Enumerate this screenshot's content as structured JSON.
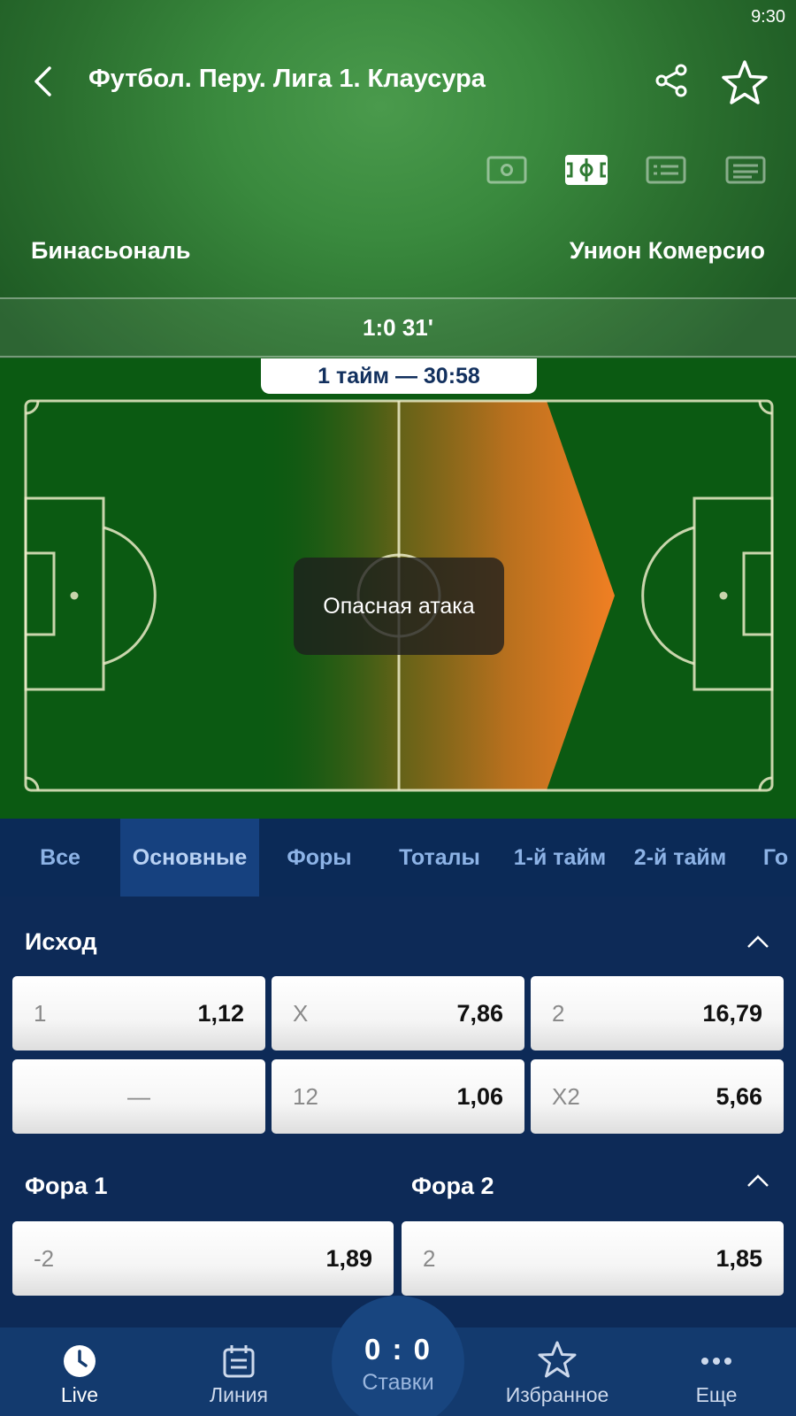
{
  "status": {
    "time": "9:30"
  },
  "header": {
    "title": "Футбол. Перу. Лига 1. Клаусура",
    "icons": [
      "back-arrow-icon",
      "share-icon",
      "star-icon"
    ],
    "view_icons": [
      "video-icon",
      "pitch-icon",
      "stats-icon",
      "text-icon"
    ],
    "active_view": "pitch-icon"
  },
  "match": {
    "home_team": "Бинасьональ",
    "away_team": "Унион Комерсио",
    "score_line": "1:0 31'",
    "period": "1 тайм — 30:58",
    "event": "Опасная атака"
  },
  "tabs": {
    "items": [
      "Все",
      "Основные",
      "Форы",
      "Тоталы",
      "1-й тайм",
      "2-й тайм",
      "Го"
    ],
    "active": "Основные"
  },
  "markets": {
    "outcome": {
      "title": "Исход",
      "odds": [
        {
          "label": "1",
          "value": "1,12"
        },
        {
          "label": "X",
          "value": "7,86"
        },
        {
          "label": "2",
          "value": "16,79"
        },
        {
          "label": "—",
          "value": ""
        },
        {
          "label": "12",
          "value": "1,06"
        },
        {
          "label": "X2",
          "value": "5,66"
        }
      ]
    },
    "handicap": {
      "title1": "Фора 1",
      "title2": "Фора 2",
      "odds": [
        {
          "label": "-2",
          "value": "1,89"
        },
        {
          "label": "2",
          "value": "1,85"
        }
      ]
    }
  },
  "bottom_nav": {
    "live": "Live",
    "line": "Линия",
    "bets_score": "0 : 0",
    "bets": "Ставки",
    "favorites": "Избранное",
    "more": "Еще"
  },
  "colors": {
    "header_green": "#3a8a3e",
    "pitch_green": "#0b5a12",
    "attack_orange": "#f07f23",
    "navy": "#0d2a57",
    "tab_active": "#16417f"
  }
}
